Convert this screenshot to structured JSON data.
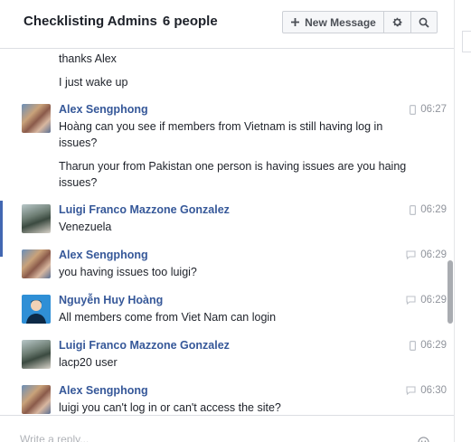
{
  "header": {
    "title": "Checklisting Admins",
    "member_count": "6 people",
    "new_message_label": "New Message"
  },
  "messages": [
    {
      "lines": [
        "thanks Alex"
      ]
    },
    {
      "lines": [
        "I just wake up"
      ]
    },
    {
      "sender": "Alex Sengphong",
      "time": "06:27",
      "device": "mobile",
      "lines": [
        "Hoàng can you see if members from Vietnam is still having log in issues?",
        "Tharun your from Pakistan one person is having issues are you haing issues?"
      ]
    },
    {
      "sender": "Luigi Franco Mazzone Gonzalez",
      "time": "06:29",
      "device": "mobile",
      "lines": [
        "Venezuela"
      ]
    },
    {
      "sender": "Alex Sengphong",
      "time": "06:29",
      "device": "chat",
      "lines": [
        "you having issues too luigi?"
      ]
    },
    {
      "sender": "Nguyễn Huy Hoàng",
      "time": "06:29",
      "device": "chat",
      "lines": [
        "All members come from Viet Nam can login"
      ]
    },
    {
      "sender": "Luigi Franco Mazzone Gonzalez",
      "time": "06:29",
      "device": "mobile",
      "lines": [
        "lacp20 user"
      ]
    },
    {
      "sender": "Alex Sengphong",
      "time": "06:30",
      "device": "chat",
      "lines": [
        "luigi you can't log in or can't access the site?"
      ]
    }
  ],
  "composer": {
    "placeholder": "Write a reply..."
  },
  "icons": {
    "new_message": "plus-icon",
    "settings": "gear-icon",
    "search": "search-icon",
    "mobile": "mobile-icon",
    "chat": "chat-bubble-icon",
    "emoji": "emoji-icon"
  },
  "colors": {
    "sender_name": "#365899",
    "accent": "#4267b2",
    "time": "#90949c"
  }
}
